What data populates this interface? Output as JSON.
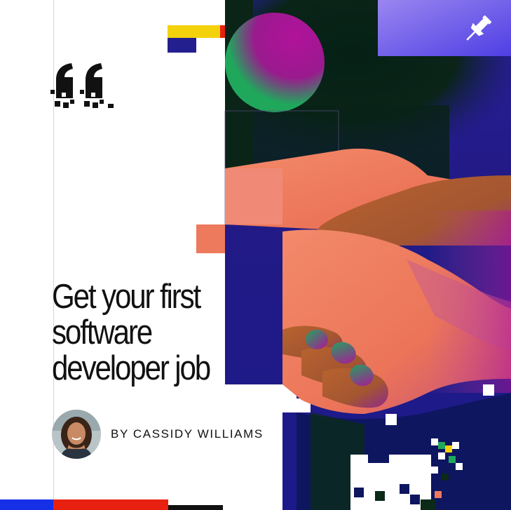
{
  "article": {
    "title_lines": [
      "Get your first",
      "software",
      "developer job"
    ],
    "byline": "BY CASSIDY WILLIAMS"
  },
  "icons": {
    "quote": "quote-icon",
    "pin": "pin-icon",
    "avatar": "author-avatar"
  },
  "colors": {
    "navy": "#241f8f",
    "dark_green": "#0b2a18",
    "magenta": "#b1129a",
    "green": "#1fa85b",
    "salmon": "#ee7a5e",
    "brown": "#b05c2e",
    "purple": "#6a5ce9",
    "yellow": "#f3d10b",
    "red": "#e8200f",
    "blue": "#1630e8"
  }
}
